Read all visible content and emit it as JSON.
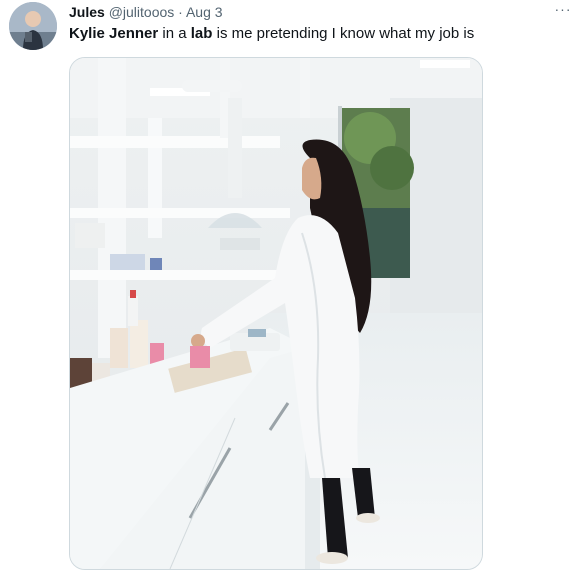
{
  "tweet": {
    "author_name": "Jules",
    "author_handle": "@julitooos",
    "separator": "·",
    "date": "Aug 3",
    "text_parts": [
      {
        "text": "Kylie Jenner",
        "bold": true
      },
      {
        "text": " in a ",
        "bold": false
      },
      {
        "text": "lab",
        "bold": true
      },
      {
        "text": " is me pretending I know what my job is",
        "bold": false
      }
    ],
    "more_label": "···"
  },
  "colors": {
    "text_primary": "#0f1419",
    "text_secondary": "#536471",
    "border": "#cfd9de"
  },
  "icons": {
    "more": "more-horizontal-icon"
  }
}
